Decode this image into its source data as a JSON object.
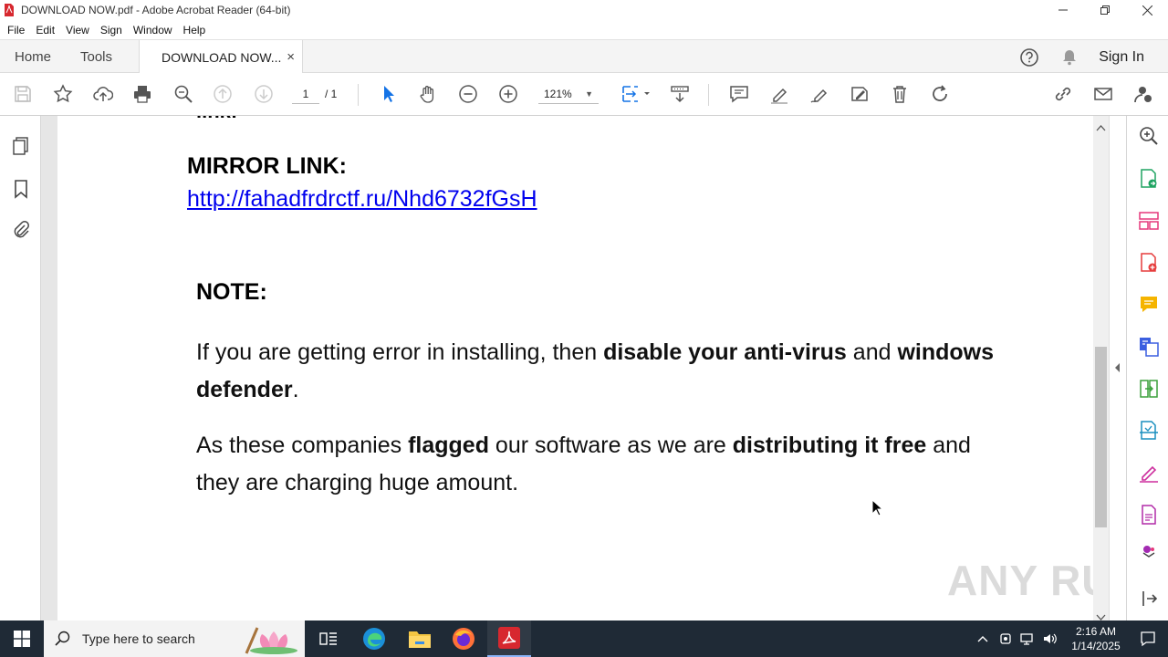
{
  "window": {
    "title": "DOWNLOAD NOW.pdf - Adobe Acrobat Reader (64-bit)"
  },
  "menu": [
    "File",
    "Edit",
    "View",
    "Sign",
    "Window",
    "Help"
  ],
  "tabs": {
    "home": "Home",
    "tools": "Tools",
    "doc": "DOWNLOAD NOW...",
    "doc_close": "×",
    "sign_in": "Sign In"
  },
  "toolbar": {
    "page_current": "1",
    "page_total": "/ 1",
    "zoom": "121%",
    "zoom_dropdown": "▼"
  },
  "document": {
    "clipped_text": "link:",
    "mirror_label": "MIRROR LINK:",
    "mirror_url": "http://fahadfrdrctf.ru/Nhd6732fGsH",
    "note_label": "NOTE:",
    "para1": {
      "t1": "If you are getting error in installing, then ",
      "b1": "disable your anti-virus",
      "t2": " and ",
      "b2": "windows defender",
      "t3": "."
    },
    "para2": {
      "t1": "As these companies ",
      "b1": "flagged",
      "t2": " our software as we are ",
      "b2": "distributing it free",
      "t3": " and they are charging huge amount."
    }
  },
  "watermark": "ANY RUN",
  "taskbar": {
    "search_placeholder": "Type here to search",
    "time": "2:16 AM",
    "date": "1/14/2025"
  },
  "colors": {
    "link": "#0000ee",
    "taskbar": "#1f2a36",
    "acrobat_red": "#d7282f"
  }
}
